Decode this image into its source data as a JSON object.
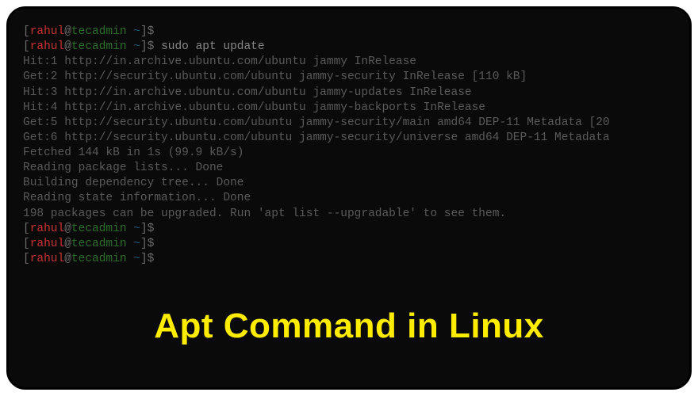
{
  "prompt": {
    "user": "rahul",
    "at": "@",
    "host": "tecadmin",
    "open": "[",
    "close": "]",
    "tilde": "~",
    "dollar": "$"
  },
  "command": "sudo apt update",
  "output": [
    "Hit:1 http://in.archive.ubuntu.com/ubuntu jammy InRelease",
    "Get:2 http://security.ubuntu.com/ubuntu jammy-security InRelease [110 kB]",
    "Hit:3 http://in.archive.ubuntu.com/ubuntu jammy-updates InRelease",
    "Hit:4 http://in.archive.ubuntu.com/ubuntu jammy-backports InRelease",
    "Get:5 http://security.ubuntu.com/ubuntu jammy-security/main amd64 DEP-11 Metadata [20",
    "Get:6 http://security.ubuntu.com/ubuntu jammy-security/universe amd64 DEP-11 Metadata",
    "Fetched 144 kB in 1s (99.9 kB/s)",
    "Reading package lists... Done",
    "Building dependency tree... Done",
    "Reading state information... Done",
    "198 packages can be upgraded. Run 'apt list --upgradable' to see them."
  ],
  "title": "Apt Command in Linux"
}
